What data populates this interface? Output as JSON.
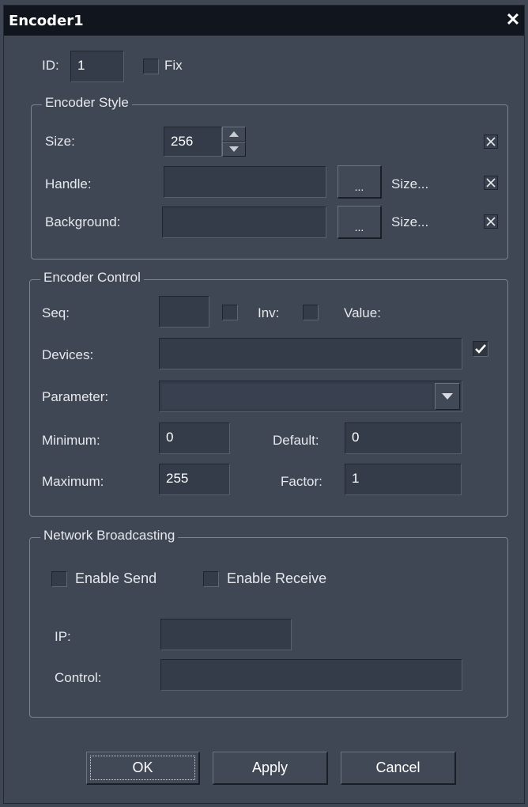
{
  "window": {
    "title": "Encoder1",
    "close_icon": "close-icon"
  },
  "id_row": {
    "id_label": "ID:",
    "id_value": "1",
    "fix_label": "Fix"
  },
  "encoder_style": {
    "legend": "Encoder Style",
    "size_label": "Size:",
    "size_value": "256",
    "handle_label": "Handle:",
    "handle_value": "",
    "handle_browse": "...",
    "handle_size": "Size...",
    "background_label": "Background:",
    "background_value": "",
    "background_browse": "...",
    "background_size": "Size..."
  },
  "encoder_control": {
    "legend": "Encoder Control",
    "seq_label": "Seq:",
    "seq_value": "",
    "inv_label": "Inv:",
    "value_label": "Value:",
    "devices_label": "Devices:",
    "devices_value": "",
    "devices_checked": true,
    "parameter_label": "Parameter:",
    "parameter_value": "",
    "minimum_label": "Minimum:",
    "minimum_value": "0",
    "default_label": "Default:",
    "default_value": "0",
    "maximum_label": "Maximum:",
    "maximum_value": "255",
    "factor_label": "Factor:",
    "factor_value": "1"
  },
  "network": {
    "legend": "Network Broadcasting",
    "enable_send": "Enable Send",
    "enable_receive": "Enable Receive",
    "ip_label": "IP:",
    "ip_value": "",
    "control_label": "Control:",
    "control_value": ""
  },
  "buttons": {
    "ok": "OK",
    "apply": "Apply",
    "cancel": "Cancel"
  },
  "colors": {
    "window_bg": "#3f4754",
    "titlebar_bg": "#11161e",
    "field_bg": "#343c49"
  }
}
